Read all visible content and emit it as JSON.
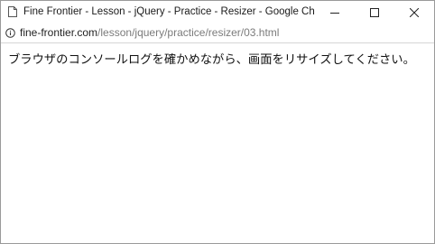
{
  "window": {
    "title": "Fine Frontier - Lesson - jQuery - Practice - Resizer - Google Chrome"
  },
  "address_bar": {
    "url_domain": "fine-frontier.com",
    "url_path": "/lesson/jquery/practice/resizer/03.html"
  },
  "page": {
    "message": "ブラウザのコンソールログを確かめながら、画面をリサイズしてください。"
  },
  "icons": {
    "page": "page-icon",
    "info": "info-icon",
    "minimize": "minimize-icon",
    "maximize": "maximize-icon",
    "close": "close-icon"
  }
}
